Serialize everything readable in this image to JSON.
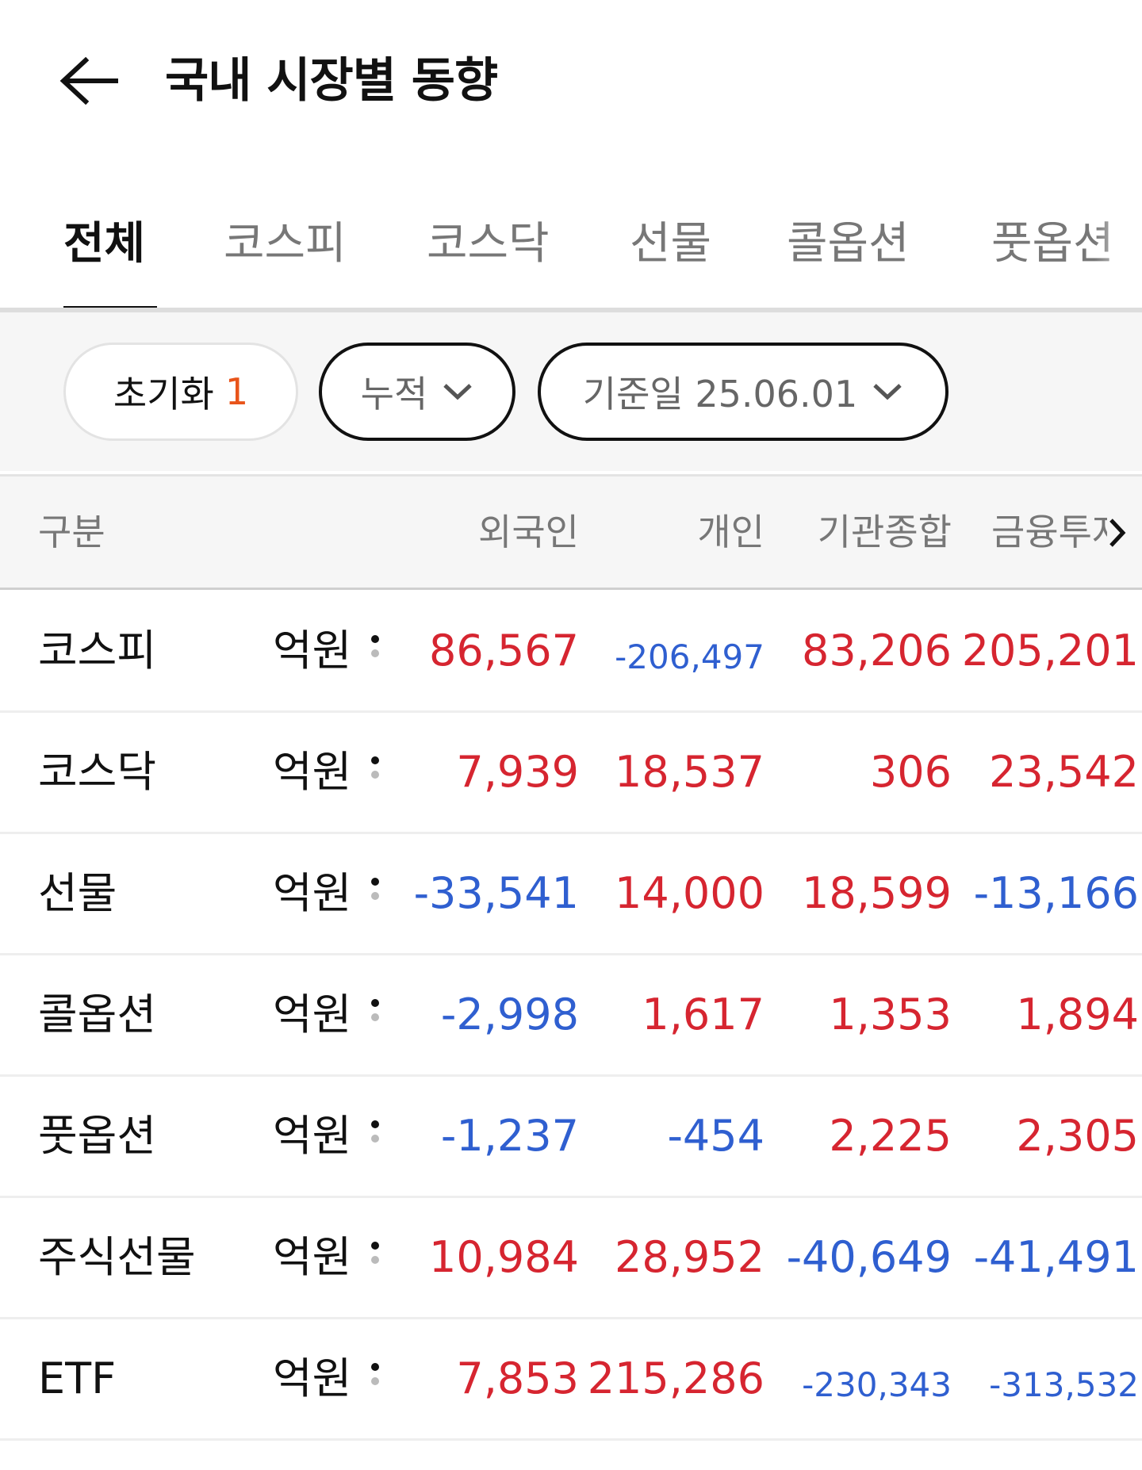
{
  "header": {
    "title": "국내 시장별 동향"
  },
  "tabs": [
    {
      "label": "전체",
      "active": true
    },
    {
      "label": "코스피"
    },
    {
      "label": "코스닥"
    },
    {
      "label": "선물"
    },
    {
      "label": "콜옵션"
    },
    {
      "label": "풋옵션"
    }
  ],
  "filters": {
    "reset_label": "초기화",
    "reset_count": "1",
    "cumulative_label": "누적",
    "date_label": "기준일 25.06.01"
  },
  "table": {
    "columns": [
      "구분",
      "외국인",
      "개인",
      "기관종합",
      "금융투자"
    ],
    "rows": [
      {
        "name": "코스피",
        "unit": "억원",
        "values": [
          "86,567",
          "-206,497",
          "83,206",
          "205,201"
        ]
      },
      {
        "name": "코스닥",
        "unit": "억원",
        "values": [
          "7,939",
          "18,537",
          "306",
          "23,542"
        ]
      },
      {
        "name": "선물",
        "unit": "억원",
        "values": [
          "-33,541",
          "14,000",
          "18,599",
          "-13,166"
        ]
      },
      {
        "name": "콜옵션",
        "unit": "억원",
        "values": [
          "-2,998",
          "1,617",
          "1,353",
          "1,894"
        ]
      },
      {
        "name": "풋옵션",
        "unit": "억원",
        "values": [
          "-1,237",
          "-454",
          "2,225",
          "2,305"
        ]
      },
      {
        "name": "주식선물",
        "unit": "억원",
        "values": [
          "10,984",
          "28,952",
          "-40,649",
          "-41,491"
        ]
      },
      {
        "name": "ETF",
        "unit": "억원",
        "values": [
          "7,853",
          "215,286",
          "-230,343",
          "-313,532"
        ]
      }
    ]
  },
  "colors": {
    "positive": "#d62530",
    "negative": "#2f5fd0",
    "accent": "#e8541a"
  },
  "icons": {
    "back": "arrow-left-icon",
    "more": "more-vertical-icon",
    "dropdown": "chevron-down-icon",
    "scroll": "chevron-right-icon"
  }
}
